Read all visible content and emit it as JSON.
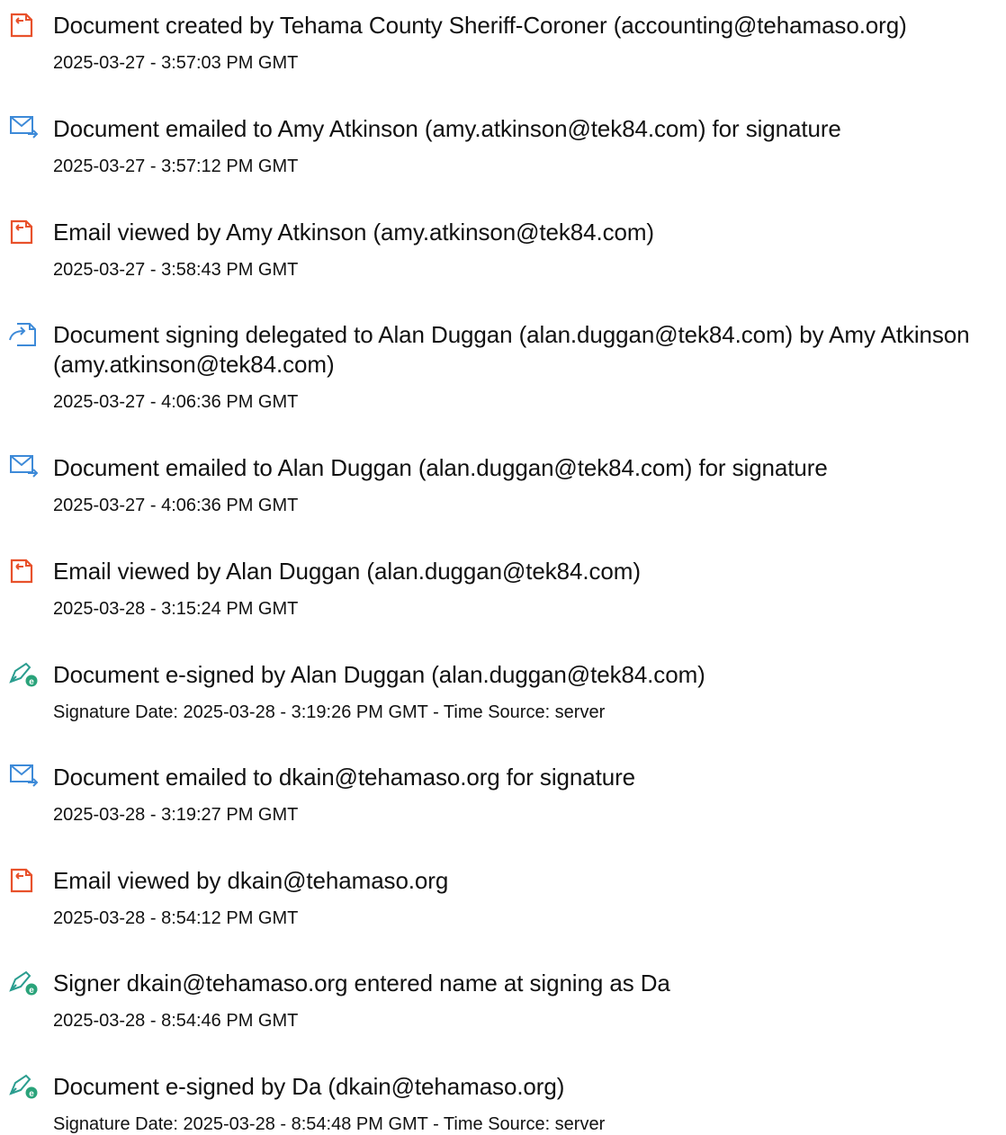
{
  "colors": {
    "doc_icon": "#e8512b",
    "mail_icon": "#3d8ad8",
    "sign_icon": "#2a9d8f",
    "sign_badge": "#2aa37a",
    "text": "#111111"
  },
  "events": [
    {
      "icon": "document-icon",
      "title": "Document created by Tehama County Sheriff-Coroner (accounting@tehamaso.org)",
      "subtitle": "2025-03-27 - 3:57:03 PM GMT"
    },
    {
      "icon": "email-icon",
      "title": "Document emailed to Amy Atkinson (amy.atkinson@tek84.com) for signature",
      "subtitle": "2025-03-27 - 3:57:12 PM GMT"
    },
    {
      "icon": "document-icon",
      "title": "Email viewed by Amy Atkinson (amy.atkinson@tek84.com)",
      "subtitle": "2025-03-27 - 3:58:43 PM GMT"
    },
    {
      "icon": "delegate-icon",
      "title": "Document signing delegated to Alan Duggan (alan.duggan@tek84.com) by Amy Atkinson (amy.atkinson@tek84.com)",
      "subtitle": "2025-03-27 - 4:06:36 PM GMT"
    },
    {
      "icon": "email-icon",
      "title": "Document emailed to Alan Duggan (alan.duggan@tek84.com) for signature",
      "subtitle": "2025-03-27 - 4:06:36 PM GMT"
    },
    {
      "icon": "document-icon",
      "title": "Email viewed by Alan Duggan (alan.duggan@tek84.com)",
      "subtitle": "2025-03-28 - 3:15:24 PM GMT"
    },
    {
      "icon": "esign-icon",
      "title": "Document e-signed by Alan Duggan (alan.duggan@tek84.com)",
      "subtitle": "Signature Date: 2025-03-28 - 3:19:26 PM GMT - Time Source: server"
    },
    {
      "icon": "email-icon",
      "title": "Document emailed to dkain@tehamaso.org for signature",
      "subtitle": "2025-03-28 - 3:19:27 PM GMT"
    },
    {
      "icon": "document-icon",
      "title": "Email viewed by dkain@tehamaso.org",
      "subtitle": "2025-03-28 - 8:54:12 PM GMT"
    },
    {
      "icon": "esign-icon",
      "title": "Signer dkain@tehamaso.org entered name at signing as Da",
      "subtitle": "2025-03-28 - 8:54:46 PM GMT"
    },
    {
      "icon": "esign-icon",
      "title": "Document e-signed by Da (dkain@tehamaso.org)",
      "subtitle": "Signature Date: 2025-03-28 - 8:54:48 PM GMT - Time Source: server"
    }
  ]
}
